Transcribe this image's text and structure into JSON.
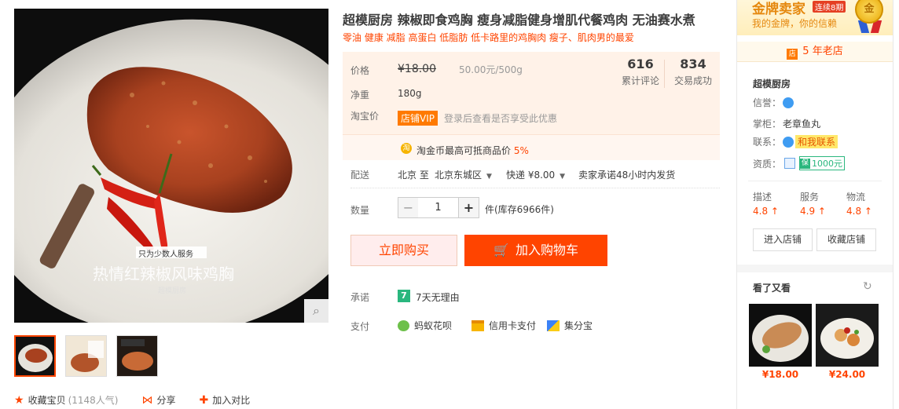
{
  "product": {
    "title": "超模厨房 辣椒即食鸡胸 瘦身减脂健身增肌代餐鸡肉 无油赛水煮",
    "subtitle": "零油 健康 减脂 高蛋白 低脂肪 低卡路里的鸡胸肉 瘦子、肌肉男的最爱",
    "image_caption_small": "只为少数人服务",
    "image_caption_big": "热情红辣椒风味鸡胸",
    "image_brand": "超模厨房"
  },
  "price": {
    "label": "价格",
    "old_price": "¥18.00",
    "unit_price": "50.00元/500g",
    "weight_label": "净重",
    "weight_value": "180g",
    "taobao_label": "淘宝价",
    "vip_tag": "店铺VIP",
    "vip_note": "登录后查看是否享受此优惠",
    "coin_text": "淘金币最高可抵商品价",
    "coin_percent": "5%"
  },
  "stats": [
    {
      "num": "616",
      "label": "累计评论"
    },
    {
      "num": "834",
      "label": "交易成功"
    }
  ],
  "shipping": {
    "label": "配送",
    "from": "北京 至",
    "to": "北京东城区",
    "express": "快递 ¥8.00",
    "promise": "卖家承诺48小时内发货"
  },
  "quantity": {
    "label": "数量",
    "minus": "−",
    "value": "1",
    "plus": "+",
    "stock": "件(库存6966件)"
  },
  "actions": {
    "buy_now": "立即购买",
    "add_cart": "加入购物车"
  },
  "service": {
    "promise_label": "承诺",
    "promise_badge": "7",
    "promise_text": "7天无理由",
    "pay_label": "支付",
    "pay_methods": [
      "蚂蚁花呗",
      "信用卡支付",
      "集分宝"
    ]
  },
  "left_actions": {
    "favorite": "收藏宝贝",
    "favorite_count": "(1148人气)",
    "share": "分享",
    "compare": "加入对比"
  },
  "seller": {
    "gold_title": "金牌卖家",
    "gold_badge": "连续8期",
    "gold_sub": "我的金牌，你的信赖",
    "medal_text": "金",
    "old_shop": "5 年老店",
    "shop_icon": "店",
    "shop_name": "超模厨房",
    "credit_label": "信誉：",
    "keeper_label": "掌柜：",
    "keeper_name": "老章鱼丸",
    "contact_label": "联系：",
    "contact_tag": "和我联系",
    "qual_label": "资质：",
    "qual_badge": "1000元",
    "scores": [
      {
        "k": "描述",
        "v": "4.8 ↑"
      },
      {
        "k": "服务",
        "v": "4.9 ↑"
      },
      {
        "k": "物流",
        "v": "4.8 ↑"
      }
    ],
    "enter_shop": "进入店铺",
    "fav_shop": "收藏店铺",
    "see_also": "看了又看",
    "recommend_prices": [
      "¥18.00",
      "¥24.00"
    ]
  },
  "colors": {
    "accent": "#ff4400",
    "price_bg": "#fff2e8",
    "gold": "#e5880e",
    "green": "#2ab77e"
  }
}
